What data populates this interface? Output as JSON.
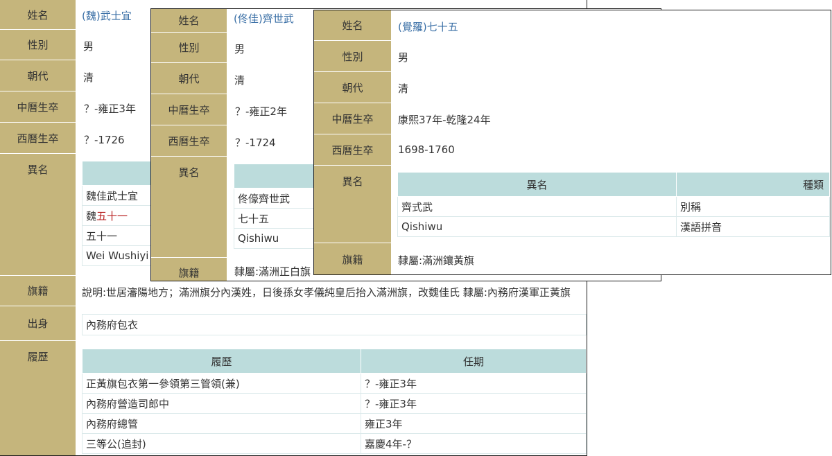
{
  "labels": {
    "name": "姓名",
    "gender": "性別",
    "dynasty": "朝代",
    "cn_dates": "中曆生卒",
    "west_dates": "西曆生卒",
    "alias": "異名",
    "banner": "旗籍",
    "origin": "出身",
    "career": "履歷"
  },
  "card1": {
    "name": "(魏)武士宜",
    "gender": "男",
    "dynasty": "清",
    "cn_dates": "？-雍正3年",
    "west_dates": "？-1726",
    "aliases": [
      "魏佳武士宜",
      "五十一",
      "五十一",
      "Wei Wushiyi"
    ],
    "alias2_prefix": "魏",
    "banner": "說明:世居瀋陽地方；滿洲旗分內漢姓，日後孫女孝儀純皇后抬入滿洲旗，改魏佳氏 隸屬:內務府漢軍正黃旗",
    "origin": "內務府包衣",
    "career_headers": [
      "履歷",
      "任期"
    ],
    "career": [
      {
        "post": "正黃旗包衣第一參領第三管領(兼)",
        "term": "？-雍正3年"
      },
      {
        "post": "內務府營造司郎中",
        "term": "？-雍正3年"
      },
      {
        "post": "內務府總管",
        "term": "雍正3年"
      },
      {
        "post": "三等公(追封)",
        "term": "嘉慶4年-？"
      }
    ]
  },
  "card2": {
    "name": "(佟佳)齊世武",
    "gender": "男",
    "dynasty": "清",
    "cn_dates": "？-雍正2年",
    "west_dates": "？-1724",
    "aliases": [
      "佟儫齊世武",
      "七十五",
      "Qishiwu"
    ],
    "banner": "隸屬:滿洲正白旗"
  },
  "card3": {
    "name": "(覺羅)七十五",
    "gender": "男",
    "dynasty": "清",
    "cn_dates": "康熙37年-乾隆24年",
    "west_dates": "1698-1760",
    "alias_headers": [
      "異名",
      "種類"
    ],
    "aliases": [
      {
        "alias": "齊式武",
        "type": "別稱"
      },
      {
        "alias": "Qishiwu",
        "type": "漢語拼音"
      }
    ],
    "banner": "隸屬:滿洲鑲黃旗"
  }
}
